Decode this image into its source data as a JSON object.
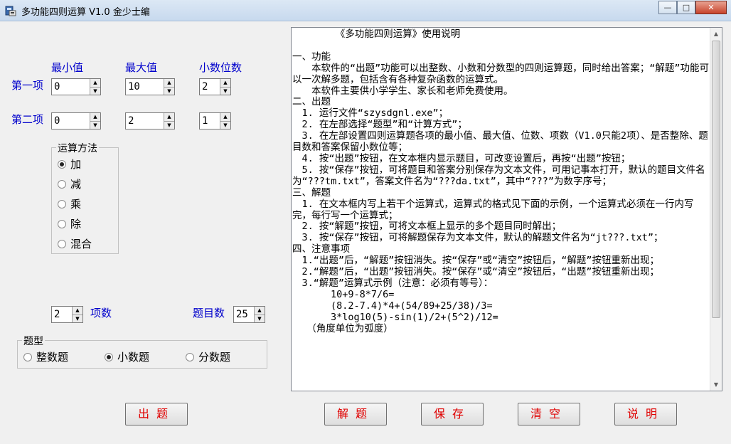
{
  "window": {
    "title": "多功能四则运算 V1.0   金少士编",
    "min_glyph": "—",
    "max_glyph": "□",
    "close_glyph": "✕",
    "app_icon": "calculator-icon"
  },
  "headers": {
    "min": "最小值",
    "max": "最大值",
    "decimals": "小数位数"
  },
  "items": [
    {
      "label": "第一项",
      "min": "0",
      "max": "10",
      "decimals": "2"
    },
    {
      "label": "第二项",
      "min": "0",
      "max": "2",
      "decimals": "1"
    }
  ],
  "operation": {
    "title": "运算方法",
    "options": [
      "加",
      "减",
      "乘",
      "除",
      "混合"
    ],
    "selected": "加"
  },
  "count": {
    "value": "2",
    "label": "项数"
  },
  "questions": {
    "label": "题目数",
    "value": "25"
  },
  "type_group": {
    "title": "题型",
    "options": [
      "整数题",
      "小数题",
      "分数题"
    ],
    "selected": "小数题"
  },
  "instructions": "　　　　　《多功能四则运算》使用说明\n\n一、功能\n　　本软件的“出题”功能可以出整数、小数和分数型的四则运算题，同时给出答案；“解题”功能可以一次解多题，包括含有各种复杂函数的运算式。\n　　本软件主要供小学学生、家长和老师免费使用。\n二、出题\n　1. 运行文件“szysdgnl.exe”；\n　2. 在左部选择“题型”和“计算方式”；\n　3. 在左部设置四则运算题各项的最小值、最大值、位数、项数（V1.0只能2项）、是否整除、题目数和答案保留小数位等；\n　4. 按“出题”按钮，在文本框内显示题目，可改变设置后，再按“出题”按钮；\n　5. 按“保存”按钮，可将题目和答案分别保存为文本文件，可用记事本打开，默认的题目文件名为“???tm.txt”，答案文件名为“???da.txt”，其中“???”为数字序号；\n三、解题\n　1. 在文本框内写上若干个运算式，运算式的格式见下面的示例，一个运算式必须在一行内写完，每行写一个运算式；\n　2. 按“解题”按钮，可将文本框上显示的多个题目同时解出；\n　3. 按“保存”按钮，可将解题保存为文本文件，默认的解题文件名为“jt???.txt”；\n四、注意事项\n　1.“出题”后，“解题”按钮消失。按“保存”或“清空”按钮后，“解题”按钮重新出现；\n　2.“解题”后，“出题”按钮消失。按“保存”或“清空”按钮后，“出题”按钮重新出现；\n　3.“解题”运算式示例（注意：必须有等号）：\n　　　　10+9-8*7/6=\n　　　　(8.2-7.4)*4+(54/89+25/38)/3=\n　　　　3*log10(5)-sin(1)/2+(5^2)/12=\n　　（角度单位为弧度）",
  "buttons": {
    "generate": "出题",
    "solve": "解题",
    "save": "保存",
    "clear": "清空",
    "help": "说明"
  },
  "colors": {
    "label_blue": "#0000cc",
    "button_red": "#e00000"
  }
}
